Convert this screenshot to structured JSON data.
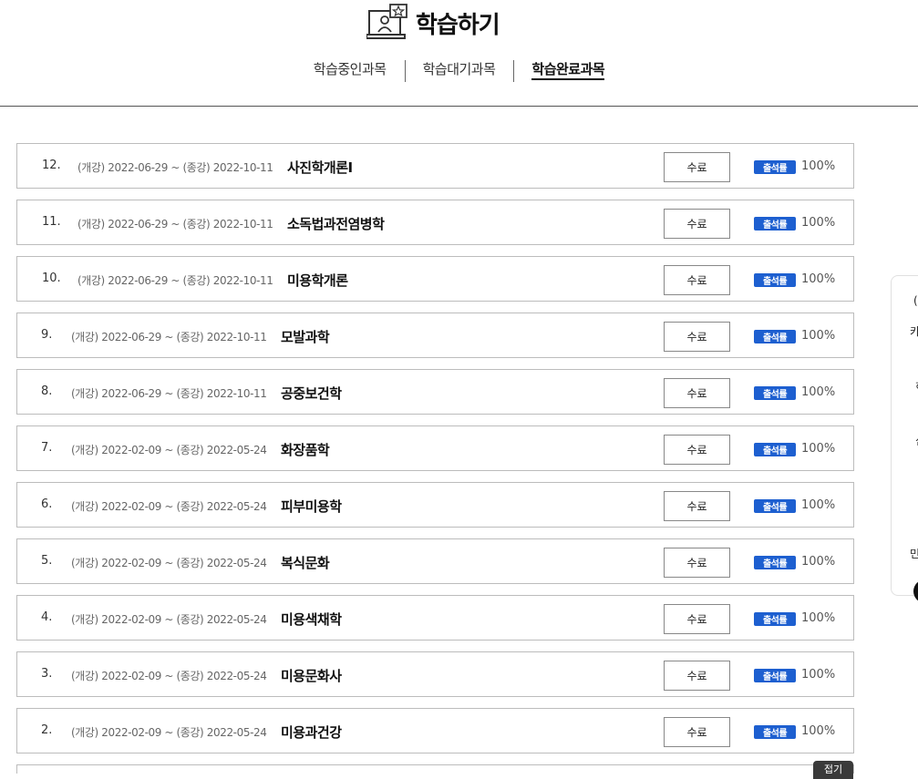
{
  "header": {
    "title": "학습하기",
    "icon": "laptop-person-star-icon"
  },
  "tabs": [
    {
      "label": "학습중인과목",
      "active": false
    },
    {
      "label": "학습대기과목",
      "active": false
    },
    {
      "label": "학습완료과목",
      "active": true
    }
  ],
  "courses": [
    {
      "num": "12.",
      "period": "(개강) 2022-06-29 ~ (종강) 2022-10-11",
      "title": "사진학개론Ⅰ",
      "status": "수료",
      "badge": "출석률",
      "rate": "100%"
    },
    {
      "num": "11.",
      "period": "(개강) 2022-06-29 ~ (종강) 2022-10-11",
      "title": "소독법과전염병학",
      "status": "수료",
      "badge": "출석률",
      "rate": "100%"
    },
    {
      "num": "10.",
      "period": "(개강) 2022-06-29 ~ (종강) 2022-10-11",
      "title": "미용학개론",
      "status": "수료",
      "badge": "출석률",
      "rate": "100%"
    },
    {
      "num": "9.",
      "period": "(개강) 2022-06-29 ~ (종강) 2022-10-11",
      "title": "모발과학",
      "status": "수료",
      "badge": "출석률",
      "rate": "100%"
    },
    {
      "num": "8.",
      "period": "(개강) 2022-06-29 ~ (종강) 2022-10-11",
      "title": "공중보건학",
      "status": "수료",
      "badge": "출석률",
      "rate": "100%"
    },
    {
      "num": "7.",
      "period": "(개강) 2022-02-09 ~ (종강) 2022-05-24",
      "title": "화장품학",
      "status": "수료",
      "badge": "출석률",
      "rate": "100%"
    },
    {
      "num": "6.",
      "period": "(개강) 2022-02-09 ~ (종강) 2022-05-24",
      "title": "피부미용학",
      "status": "수료",
      "badge": "출석률",
      "rate": "100%"
    },
    {
      "num": "5.",
      "period": "(개강) 2022-02-09 ~ (종강) 2022-05-24",
      "title": "복식문화",
      "status": "수료",
      "badge": "출석률",
      "rate": "100%"
    },
    {
      "num": "4.",
      "period": "(개강) 2022-02-09 ~ (종강) 2022-05-24",
      "title": "미용색채학",
      "status": "수료",
      "badge": "출석률",
      "rate": "100%"
    },
    {
      "num": "3.",
      "period": "(개강) 2022-02-09 ~ (종강) 2022-05-24",
      "title": "미용문화사",
      "status": "수료",
      "badge": "출석률",
      "rate": "100%"
    },
    {
      "num": "2.",
      "period": "(개강) 2022-02-09 ~ (종강) 2022-05-24",
      "title": "미용과건강",
      "status": "수료",
      "badge": "출석률",
      "rate": "100%"
    }
  ],
  "side_panel": {
    "fragments": [
      "(",
      "카",
      "히",
      "심",
      "민"
    ]
  },
  "fold_button": "접기",
  "colors": {
    "badge": "#1d5fd0",
    "border": "#bcbcbc"
  }
}
